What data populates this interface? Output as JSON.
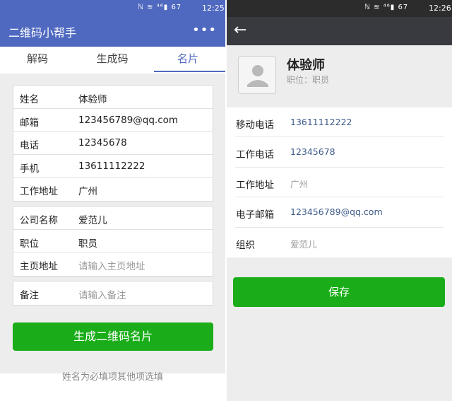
{
  "left": {
    "status": {
      "icons": "ℕ ≋ ⁴⁶▮ 67",
      "time": "12:25"
    },
    "app_title": "二维码小帮手",
    "more_icon": "•••",
    "tabs": [
      {
        "label": "解码"
      },
      {
        "label": "生成码"
      },
      {
        "label": "名片"
      }
    ],
    "group1": [
      {
        "label": "姓名",
        "value": "体验师"
      },
      {
        "label": "邮箱",
        "value": "123456789@qq.com"
      },
      {
        "label": "电话",
        "value": "12345678"
      },
      {
        "label": "手机",
        "value": "13611112222"
      },
      {
        "label": "工作地址",
        "value": "广州"
      }
    ],
    "group2": [
      {
        "label": "公司名称",
        "value": "爱范儿"
      },
      {
        "label": "职位",
        "value": "职员"
      },
      {
        "label": "主页地址",
        "placeholder": "请输入主页地址"
      }
    ],
    "group3": [
      {
        "label": "备注",
        "placeholder": "请输入备注"
      }
    ],
    "generate_button": "生成二维码名片",
    "hint": "姓名为必填项其他项选填"
  },
  "right": {
    "status": {
      "icons": "ℕ ≋ ⁴⁶▮ 67",
      "time": "12:26"
    },
    "back_icon": "←",
    "name": "体验师",
    "position": "职位：职员",
    "rows": [
      {
        "label": "移动电话",
        "value": "13611112222"
      },
      {
        "label": "工作电话",
        "value": "12345678"
      },
      {
        "label": "工作地址",
        "value": "广州"
      },
      {
        "label": "电子邮箱",
        "value": "123456789@qq.com"
      },
      {
        "label": "组织",
        "value": "爱范儿"
      }
    ],
    "save_button": "保存"
  },
  "colors": {
    "brand": "#4f69c0",
    "green": "#1aad19",
    "dark": "#393a3f"
  }
}
